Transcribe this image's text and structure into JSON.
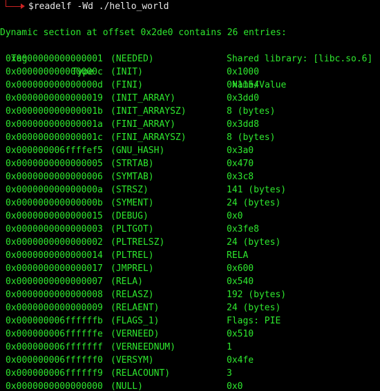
{
  "terminal": {
    "command": "$readelf -Wd ./hello_world",
    "summary": "Dynamic section at offset 0x2de0 contains 26 entries:",
    "headers": {
      "tag": "Tag",
      "type": "Type",
      "name_value": "Name/Value"
    },
    "entries": [
      {
        "tag": "0x0000000000000001",
        "type": "(NEEDED)",
        "value": "Shared library: [libc.so.6]"
      },
      {
        "tag": "0x000000000000000c",
        "type": "(INIT)",
        "value": "0x1000"
      },
      {
        "tag": "0x000000000000000d",
        "type": "(FINI)",
        "value": "0x1154"
      },
      {
        "tag": "0x0000000000000019",
        "type": "(INIT_ARRAY)",
        "value": "0x3dd0"
      },
      {
        "tag": "0x000000000000001b",
        "type": "(INIT_ARRAYSZ)",
        "value": "8 (bytes)"
      },
      {
        "tag": "0x000000000000001a",
        "type": "(FINI_ARRAY)",
        "value": "0x3dd8"
      },
      {
        "tag": "0x000000000000001c",
        "type": "(FINI_ARRAYSZ)",
        "value": "8 (bytes)"
      },
      {
        "tag": "0x000000006ffffef5",
        "type": "(GNU_HASH)",
        "value": "0x3a0"
      },
      {
        "tag": "0x0000000000000005",
        "type": "(STRTAB)",
        "value": "0x470"
      },
      {
        "tag": "0x0000000000000006",
        "type": "(SYMTAB)",
        "value": "0x3c8"
      },
      {
        "tag": "0x000000000000000a",
        "type": "(STRSZ)",
        "value": "141 (bytes)"
      },
      {
        "tag": "0x000000000000000b",
        "type": "(SYMENT)",
        "value": "24 (bytes)"
      },
      {
        "tag": "0x0000000000000015",
        "type": "(DEBUG)",
        "value": "0x0"
      },
      {
        "tag": "0x0000000000000003",
        "type": "(PLTGOT)",
        "value": "0x3fe8"
      },
      {
        "tag": "0x0000000000000002",
        "type": "(PLTRELSZ)",
        "value": "24 (bytes)"
      },
      {
        "tag": "0x0000000000000014",
        "type": "(PLTREL)",
        "value": "RELA"
      },
      {
        "tag": "0x0000000000000017",
        "type": "(JMPREL)",
        "value": "0x600"
      },
      {
        "tag": "0x0000000000000007",
        "type": "(RELA)",
        "value": "0x540"
      },
      {
        "tag": "0x0000000000000008",
        "type": "(RELASZ)",
        "value": "192 (bytes)"
      },
      {
        "tag": "0x0000000000000009",
        "type": "(RELAENT)",
        "value": "24 (bytes)"
      },
      {
        "tag": "0x000000006ffffffb",
        "type": "(FLAGS_1)",
        "value": "Flags: PIE"
      },
      {
        "tag": "0x000000006ffffffe",
        "type": "(VERNEED)",
        "value": "0x510"
      },
      {
        "tag": "0x000000006fffffff",
        "type": "(VERNEEDNUM)",
        "value": "1"
      },
      {
        "tag": "0x000000006ffffff0",
        "type": "(VERSYM)",
        "value": "0x4fe"
      },
      {
        "tag": "0x000000006ffffff9",
        "type": "(RELACOUNT)",
        "value": "3"
      },
      {
        "tag": "0x0000000000000000",
        "type": "(NULL)",
        "value": "0x0"
      }
    ]
  },
  "colors": {
    "background": "#000000",
    "text": "#2ee82e",
    "command": "#e8e8e8",
    "prompt": "#cc2222"
  }
}
